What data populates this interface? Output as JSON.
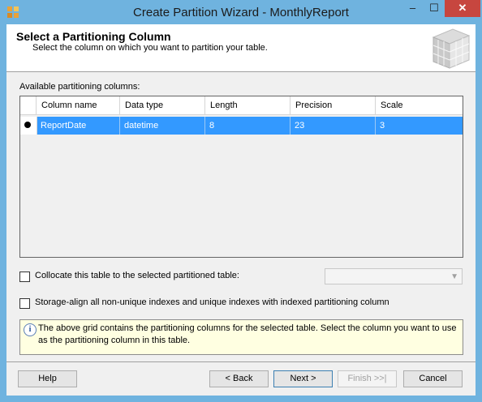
{
  "window": {
    "title": "Create Partition Wizard - MonthlyReport"
  },
  "titlebar": {
    "minimize": "–",
    "maximize": "☐",
    "close": "✕"
  },
  "header": {
    "title": "Select a Partitioning Column",
    "subtitle": "Select the column on which you want to partition your table."
  },
  "grid": {
    "label": "Available partitioning columns:",
    "columns": [
      "Column name",
      "Data type",
      "Length",
      "Precision",
      "Scale"
    ],
    "rows": [
      {
        "selected": true,
        "cells": [
          "ReportDate",
          "datetime",
          "8",
          "23",
          "3"
        ]
      }
    ]
  },
  "options": {
    "collocate_label": "Collocate this table to the selected partitioned table:",
    "storage_align_label": "Storage-align all non-unique indexes and unique indexes with indexed partitioning column"
  },
  "info": {
    "icon": "i",
    "text": "The above grid contains the partitioning columns for the selected table. Select the column you want to use as the partitioning column in this table."
  },
  "buttons": {
    "help": "Help",
    "back": "< Back",
    "next": "Next >",
    "finish": "Finish >>|",
    "cancel": "Cancel"
  }
}
